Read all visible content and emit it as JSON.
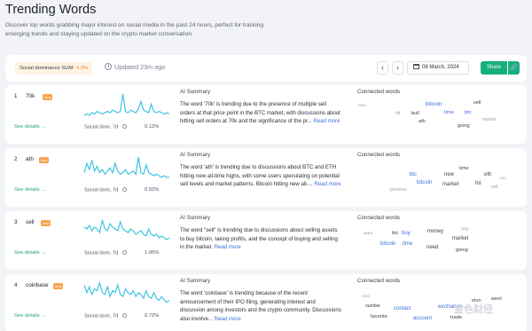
{
  "header": {
    "title": "Trending Words",
    "description": "Discover top words grabbing major interest on social media in the past 24 hours, perfect for tracking emerging trends and staying updated on the crypto market conversation."
  },
  "toolbar": {
    "dominance_label": "Social dominance SUM:",
    "dominance_value": "4.3%",
    "updated": "Updated 23m ago",
    "prev_icon": "‹",
    "next_icon": "›",
    "date": "08 March, 2024",
    "share_label": "Share",
    "link_icon": "🔗"
  },
  "common": {
    "see_details": "See details →",
    "social_dom_label": "Social dom, 7d",
    "ai_summary_title": "AI Summary",
    "connected_title": "Connected words",
    "read_more": "Read more",
    "new_tag": "new"
  },
  "colors": {
    "accent": "#16b07a",
    "sparkline": "#3ec6e0",
    "link": "#3b6fd8",
    "new_tag": "#f7a34b"
  },
  "words": [
    {
      "rank": "1",
      "word": "70k",
      "pct": "0.12%",
      "summary": "The word '70k' is trending due to the presence of multiple sell orders at that price point in the BTC market, with discussions about hitting sell orders at 70k and the significance of the pr...",
      "connected": [
        "now",
        "bitcoin",
        "sell",
        "bull",
        "hit",
        "time",
        "btc",
        "ath",
        "going",
        "market"
      ],
      "spark": [
        3,
        4,
        3,
        5,
        4,
        6,
        5,
        4,
        5,
        6,
        5,
        7,
        6,
        5,
        6,
        20,
        6,
        5,
        7,
        6,
        5,
        8,
        14,
        7,
        6,
        5,
        12,
        6,
        5,
        6,
        5,
        4,
        5,
        4
      ]
    },
    {
      "rank": "2",
      "word": "ath",
      "pct": "0.52%",
      "summary": "The word 'ath' is trending due to discussions about BTC and ETH hitting new all-time highs, with some users speculating on potential sell levels and market patterns. Bitcoin hitting new all-...",
      "connected": [
        "time",
        "btc",
        "new",
        "eth",
        "bitcoin",
        "run",
        "market",
        "hit",
        "previous",
        "sell"
      ],
      "spark": [
        6,
        12,
        8,
        14,
        7,
        10,
        6,
        8,
        5,
        7,
        9,
        6,
        12,
        7,
        5,
        6,
        8,
        5,
        6,
        7,
        5,
        16,
        6,
        5,
        11,
        6,
        5,
        4,
        5,
        4,
        3,
        4,
        3,
        3
      ]
    },
    {
      "rank": "3",
      "word": "sell",
      "pct": "1.95%",
      "summary": "The word \"sell\" is trending due to discussions about selling assets to buy bitcoin, taking profits, and the concept of buying and selling in the market.",
      "connected": [
        "want",
        "btc",
        "buy",
        "money",
        "way",
        "market",
        "bitcoin",
        "time",
        "need",
        "going"
      ],
      "spark": [
        10,
        9,
        11,
        8,
        10,
        9,
        7,
        14,
        9,
        8,
        12,
        10,
        9,
        8,
        13,
        9,
        8,
        7,
        9,
        8,
        6,
        7,
        8,
        6,
        5,
        9,
        6,
        5,
        6,
        4,
        5,
        4,
        3,
        4
      ]
    },
    {
      "rank": "4",
      "word": "coinbase",
      "pct": "0.72%",
      "summary": "The word 'coinbase' is trending because of the recent announcement of their IPO filing, generating interest and discussion among investors and the crypto community. Discussions also involve...",
      "connected": [
        "now",
        "elon",
        "went",
        "number",
        "contact",
        "exchange",
        "favorite",
        "account",
        "trade"
      ],
      "spark": [
        12,
        8,
        11,
        7,
        10,
        9,
        13,
        8,
        7,
        11,
        6,
        9,
        8,
        12,
        7,
        6,
        10,
        8,
        7,
        9,
        6,
        8,
        7,
        5,
        9,
        6,
        5,
        8,
        5,
        4,
        6,
        4,
        3,
        4
      ]
    }
  ],
  "watermark": "金色财经"
}
